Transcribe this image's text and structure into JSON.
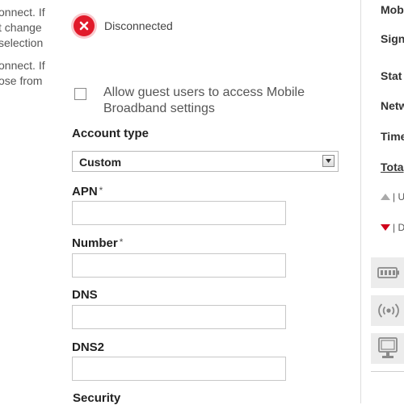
{
  "left_fragments": [
    "onnect. If",
    "t change",
    "selection",
    "onnect. If",
    "ose from"
  ],
  "status": {
    "label": "Disconnected",
    "icon": "disconnected-icon",
    "color": "#e11a2a"
  },
  "guest_access": {
    "label": "Allow guest users to access Mobile Broadband settings",
    "checked": false
  },
  "account_type": {
    "label": "Account type",
    "selected": "Custom"
  },
  "fields": [
    {
      "label": "APN",
      "required": "*",
      "value": ""
    },
    {
      "label": "Number",
      "required": "*",
      "value": ""
    },
    {
      "label": "DNS",
      "required": "",
      "value": ""
    },
    {
      "label": "DNS2",
      "required": "",
      "value": ""
    }
  ],
  "security_label": "Security",
  "right_panel": {
    "labels": [
      "Mobi",
      "Sign",
      "Stat",
      "Netw",
      "Time"
    ],
    "total": "Tota",
    "upload": "| U",
    "download": "| D",
    "icons": [
      "battery-icon",
      "wireless-signal-icon",
      "monitor-icon"
    ],
    "upload_color": "#aaaaaa",
    "download_color": "#d0021b"
  }
}
